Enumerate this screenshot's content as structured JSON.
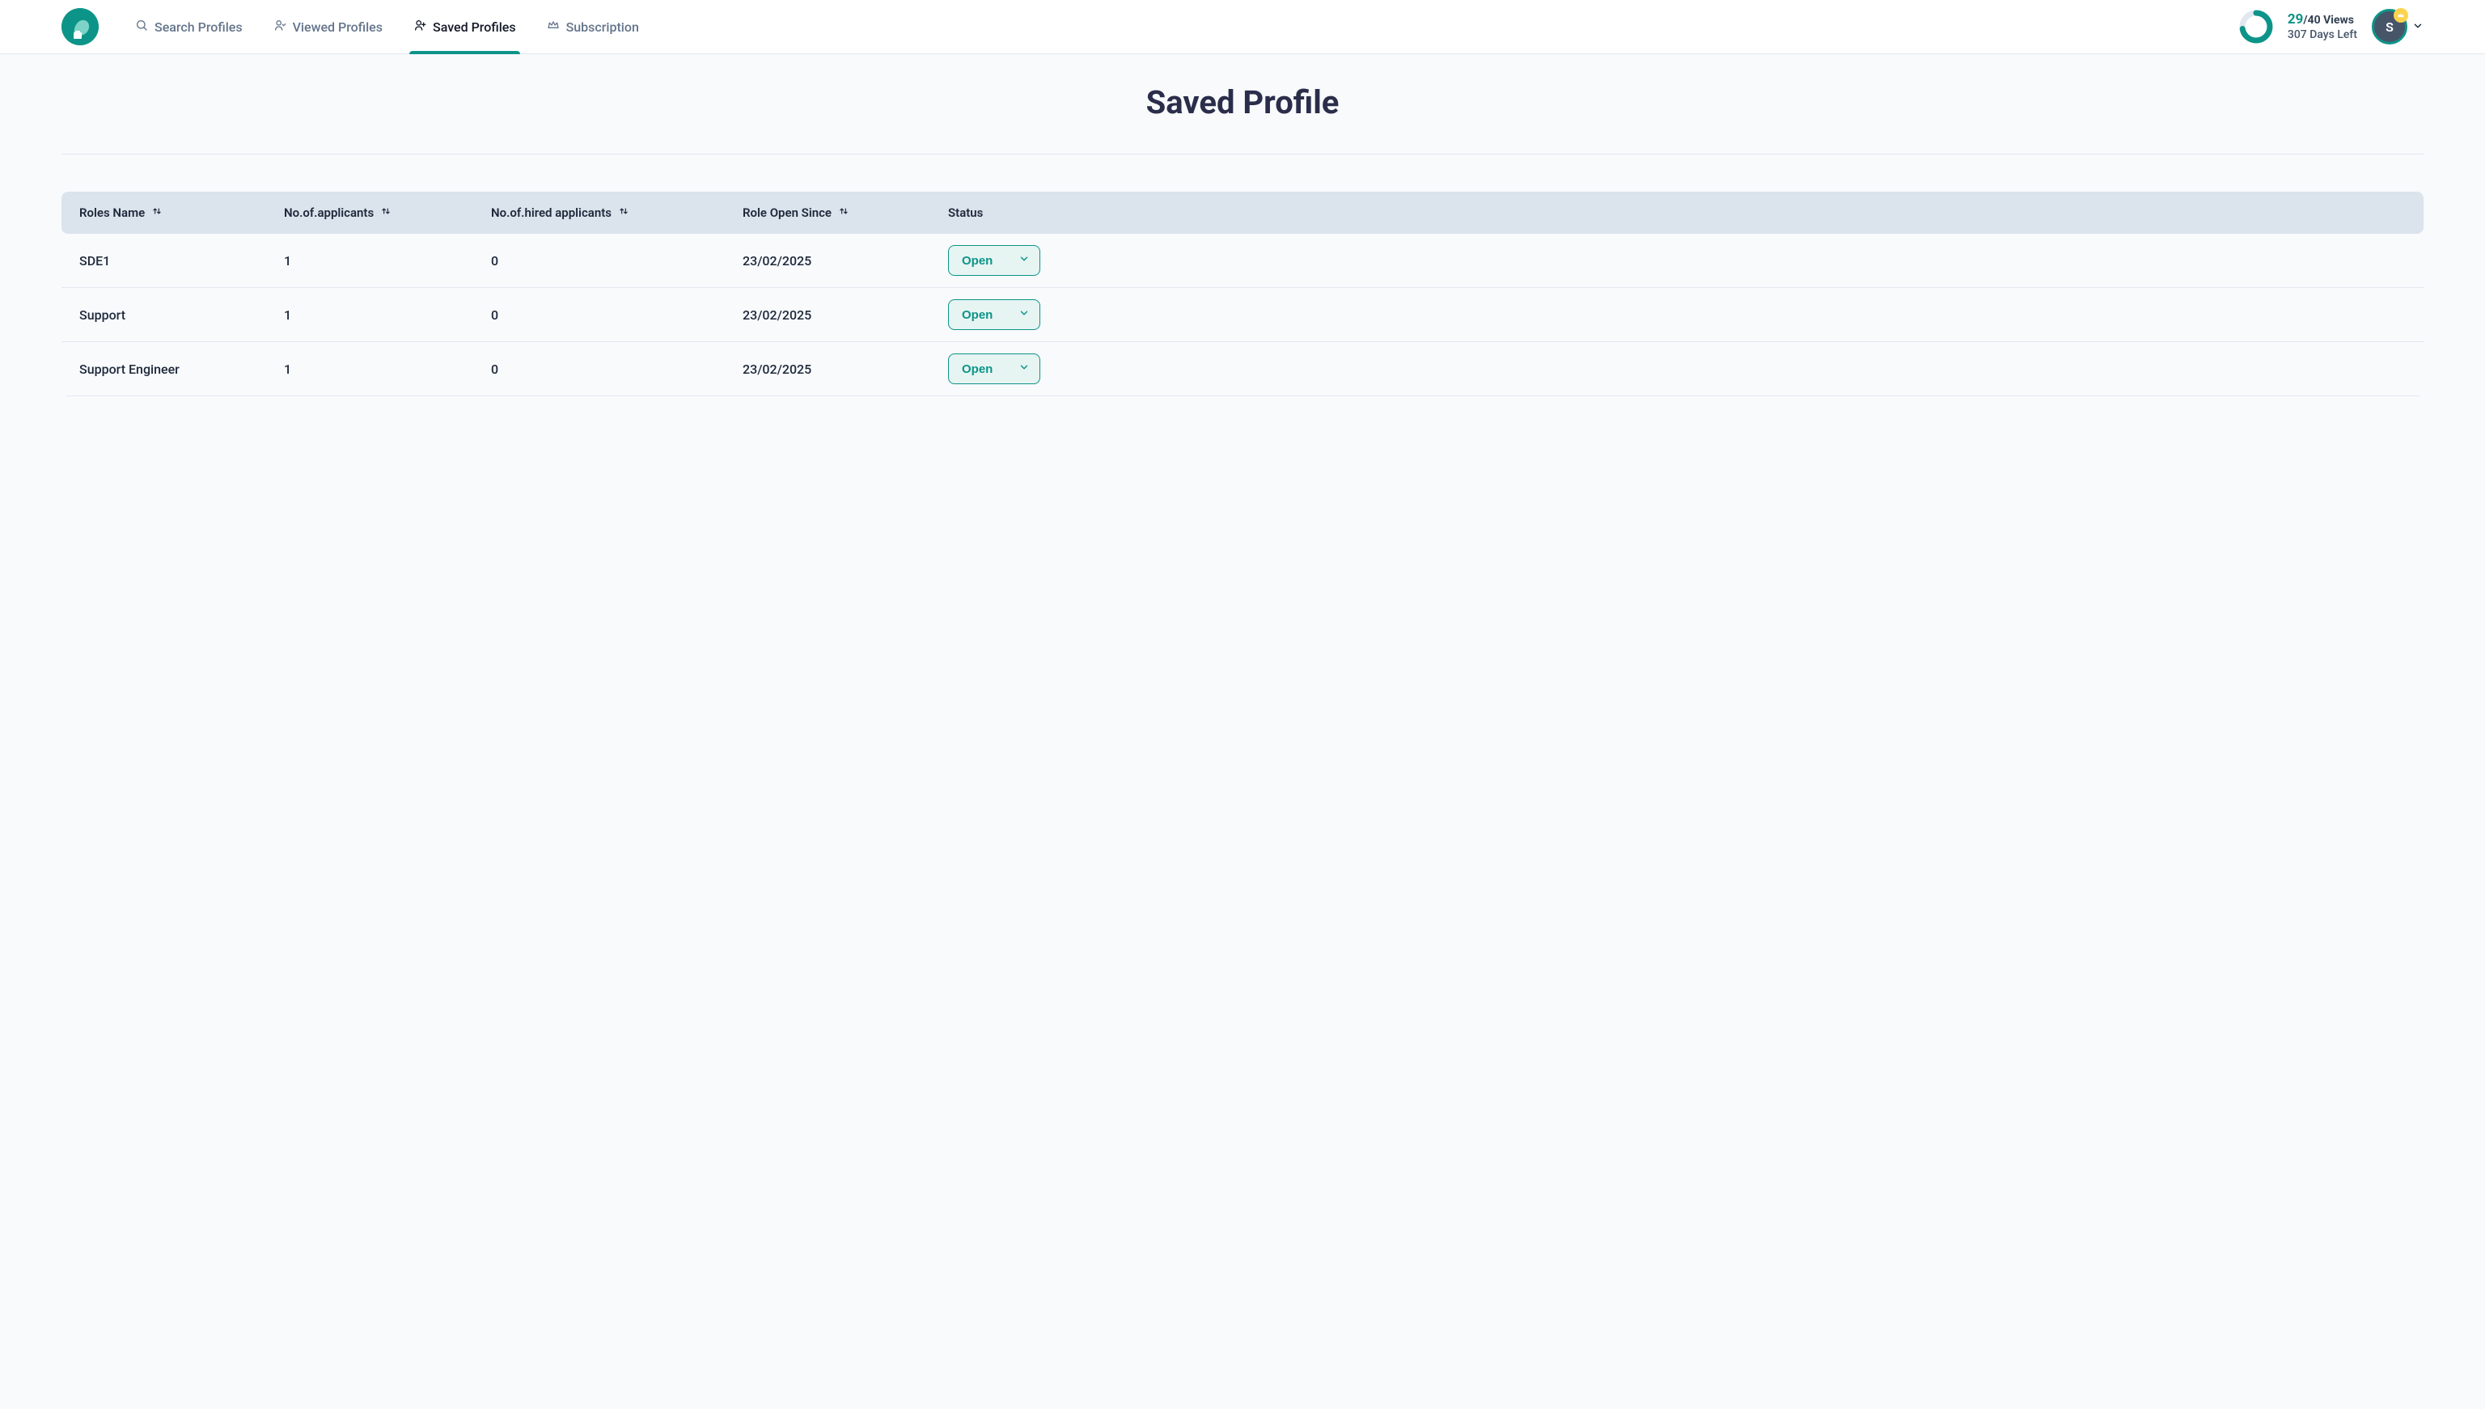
{
  "nav": {
    "search": "Search Profiles",
    "viewed": "Viewed Profiles",
    "saved": "Saved Profiles",
    "subscription": "Subscription",
    "active": "saved"
  },
  "usage": {
    "used": "29",
    "total_suffix": "/40 Views",
    "days_left": "307 Days Left",
    "ring_used": 29,
    "ring_total": 40
  },
  "avatar_initial": "S",
  "page_title": "Saved Profile",
  "columns": {
    "roles": "Roles Name",
    "applicants": "No.of.applicants",
    "hired": "No.of.hired applicants",
    "open_since": "Role Open Since",
    "status": "Status"
  },
  "rows": [
    {
      "role": "SDE1",
      "applicants": "1",
      "hired": "0",
      "open_since": "23/02/2025",
      "status": "Open"
    },
    {
      "role": "Support",
      "applicants": "1",
      "hired": "0",
      "open_since": "23/02/2025",
      "status": "Open"
    },
    {
      "role": "Support Engineer",
      "applicants": "1",
      "hired": "0",
      "open_since": "23/02/2025",
      "status": "Open"
    }
  ],
  "colors": {
    "brand": "#0d9488",
    "header_row": "#dbe3ec",
    "status_bg": "#e6f4f2"
  }
}
